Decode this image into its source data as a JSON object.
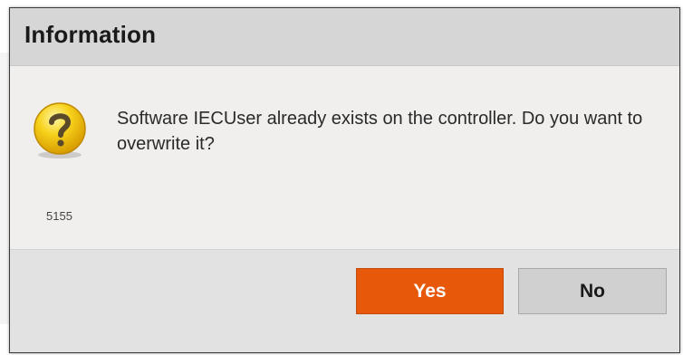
{
  "dialog": {
    "title": "Information",
    "message": "Software IECUser already exists on the controller. Do you want to overwrite it?",
    "code": "5155",
    "icon": "question-icon",
    "buttons": {
      "yes_label": "Yes",
      "no_label": "No"
    }
  },
  "colors": {
    "primary_button": "#e8580a",
    "secondary_button": "#d0d0d0",
    "title_bar": "#d6d6d6",
    "icon": "#f4c20d"
  }
}
